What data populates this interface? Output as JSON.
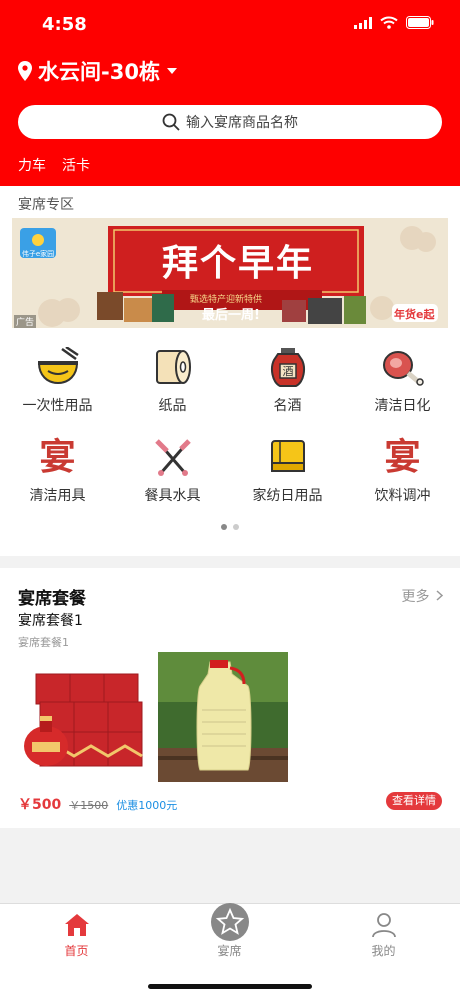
{
  "status_bar": {
    "time": "4:58"
  },
  "header": {
    "location": "水云间-30栋",
    "search_placeholder": "输入宴席商品名称",
    "links": [
      "力车",
      "活卡"
    ]
  },
  "section": {
    "title": "宴席专区"
  },
  "banner": {
    "brand": "伟子e家园",
    "slogan": "拜个早年",
    "subtitle": "甄选特产迎新特供",
    "tagline": "最后一周!",
    "ad_label": "广告",
    "corner": "年货e起"
  },
  "categories": [
    {
      "label": "一次性用品",
      "icon": "bowl-icon"
    },
    {
      "label": "纸品",
      "icon": "tissue-roll-icon"
    },
    {
      "label": "名酒",
      "icon": "liquor-jar-icon",
      "badge": "酒"
    },
    {
      "label": "清洁日化",
      "icon": "ham-icon"
    },
    {
      "label": "清洁用具",
      "icon": "yan-char-icon",
      "glyph": "宴"
    },
    {
      "label": "餐具水具",
      "icon": "fork-knife-icon"
    },
    {
      "label": "家纺日用品",
      "icon": "towel-icon"
    },
    {
      "label": "饮料调冲",
      "icon": "yan-char-icon",
      "glyph": "宴"
    }
  ],
  "package": {
    "title": "宴席套餐",
    "more": "更多",
    "name": "宴席套餐1",
    "sub": "宴席套餐1",
    "price": "￥500",
    "original_price": "￥1500",
    "discount": "优惠1000元",
    "detail_button": "查看详情"
  },
  "tabbar": [
    {
      "label": "首页",
      "icon": "home-icon",
      "active": true
    },
    {
      "label": "宴席",
      "icon": "star-icon",
      "active": false
    },
    {
      "label": "我的",
      "icon": "user-icon",
      "active": false
    }
  ],
  "colors": {
    "brand_red": "#fe0000",
    "price_red": "#e4393c",
    "discount_blue": "#1c8fe3"
  }
}
